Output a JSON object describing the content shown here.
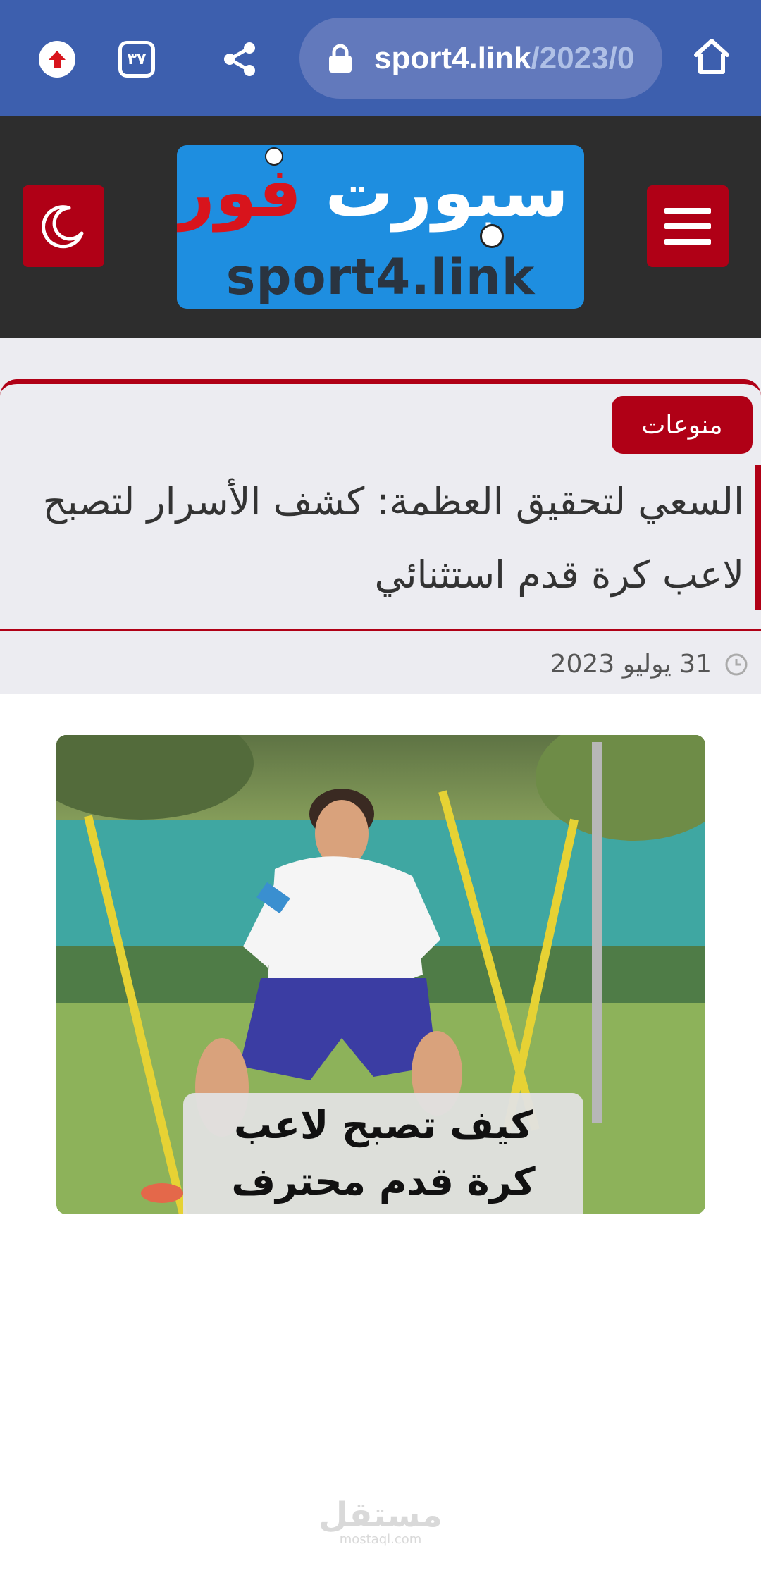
{
  "browser": {
    "url_host": "sport4.link",
    "url_path": "/2023/0",
    "tabs_count": "٣٧"
  },
  "site": {
    "logo_ar_word1": "سبورت",
    "logo_ar_word2": "فور",
    "logo_en": "sport4.link"
  },
  "article": {
    "category": "منوعات",
    "title": "السعي لتحقيق العظمة: كشف الأسرار لتصبح لاعب كرة قدم استثنائي",
    "date": "31 يوليو 2023",
    "image_caption_line1": "كيف تصبح لاعب",
    "image_caption_line2": "كرة قدم محترف"
  },
  "watermark": {
    "ar": "مستقل",
    "en": "mostaql.com"
  },
  "colors": {
    "browser_bar": "#3D5FAE",
    "site_header": "#2D2D2D",
    "accent_red": "#B00016",
    "logo_blue": "#1E8EE0"
  },
  "icons": [
    "upload-arrow-icon",
    "tabs-count-icon",
    "share-icon",
    "lock-icon",
    "home-icon",
    "moon-icon",
    "hamburger-menu-icon",
    "clock-icon"
  ]
}
